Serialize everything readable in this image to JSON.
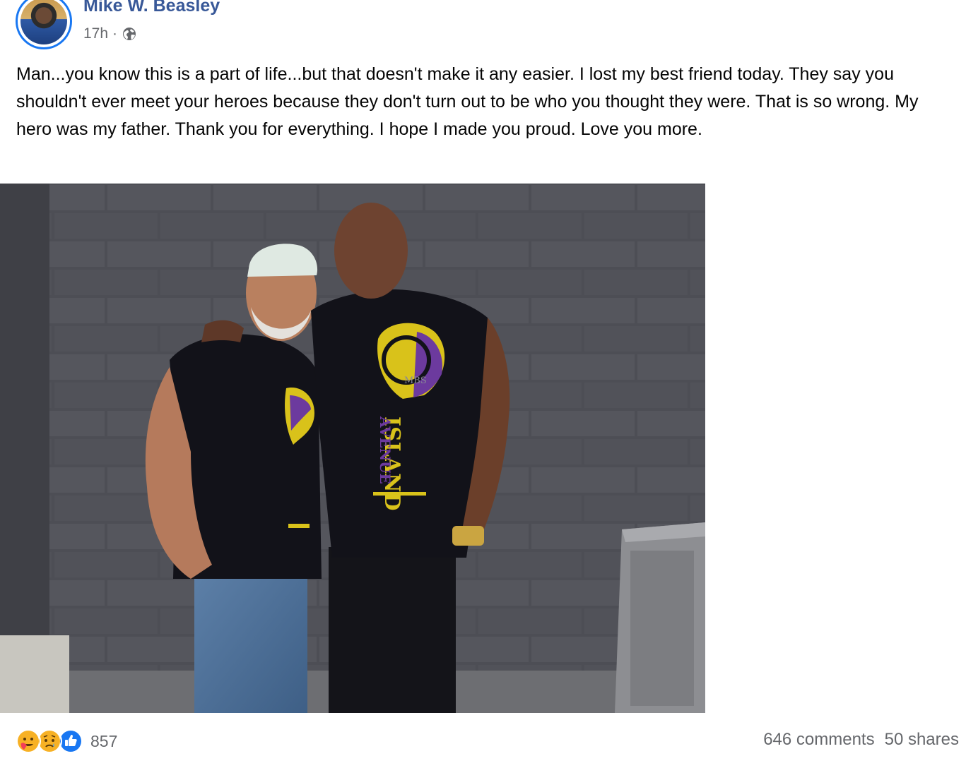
{
  "post": {
    "author": "Mike W. Beasley",
    "time": "17h",
    "separator": "·",
    "privacy_icon": "globe-icon",
    "text": "Man...you know this is a part of life...but that doesn't make it any easier. I lost my best friend today. They say you shouldn't ever meet your heroes because they don't turn out to be who you thought they were. That is so wrong. My hero was my father. Thank you for everything. I hope I made you proud. Love you more.",
    "photo_shirt_text": [
      "ISLAND",
      "AVENUE",
      "MBS"
    ]
  },
  "footer": {
    "reaction_icons": [
      "care-reaction-icon",
      "sad-reaction-icon",
      "like-reaction-icon"
    ],
    "reaction_count": "857",
    "comments": "646 comments",
    "shares": "50 shares"
  },
  "colors": {
    "author_link": "#385898",
    "meta_gray": "#65676b",
    "like_blue": "#1877f2",
    "reaction_yellow": "#f7b125"
  }
}
